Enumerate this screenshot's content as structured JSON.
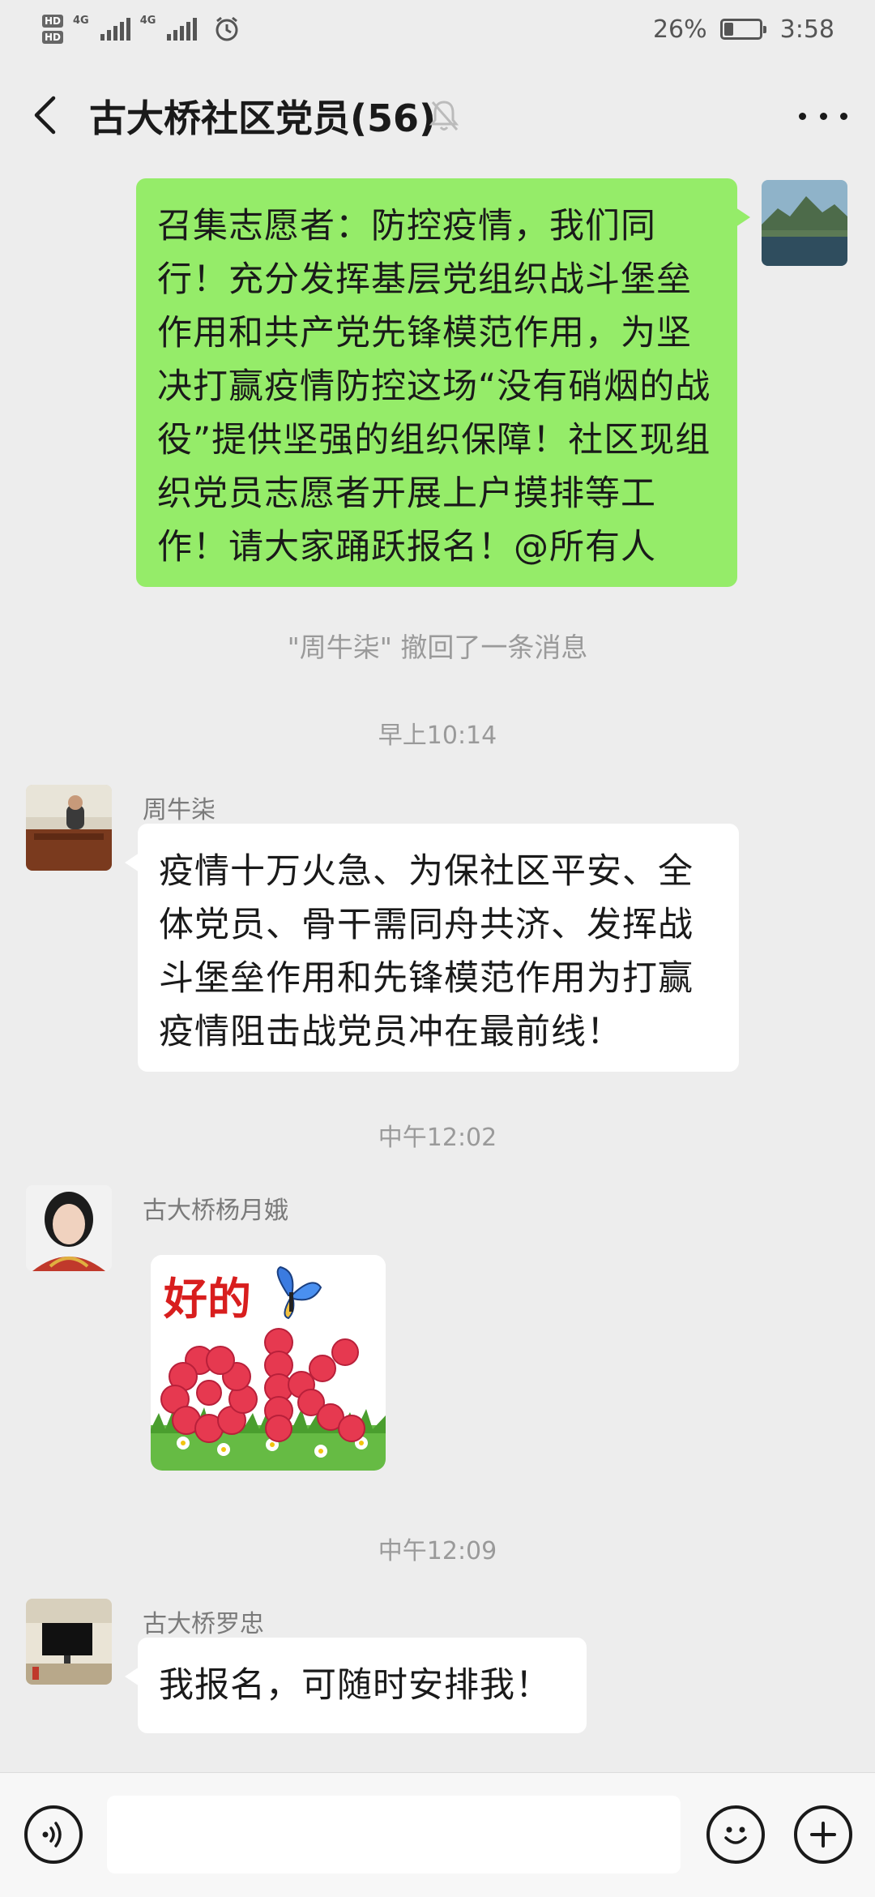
{
  "status_bar": {
    "hd1": "HD",
    "hd2": "HD",
    "net1": "4G",
    "net2": "4G",
    "battery_text": "26%",
    "battery_level": 0.26,
    "time": "3:58"
  },
  "header": {
    "title": "古大桥社区党员(56)"
  },
  "messages": {
    "m1_text": "召集志愿者：防控疫情，我们同行！充分发挥基层党组织战斗堡垒作用和共产党先锋模范作用，为坚决打赢疫情防控这场“没有硝烟的战役”提供坚强的组织保障！社区现组织党员志愿者开展上户摸排等工作！请大家踊跃报名！@所有人",
    "recall_note": "\"周牛柒\" 撤回了一条消息",
    "ts1": "早上10:14",
    "m2_sender": "周牛柒",
    "m2_text": "疫情十万火急、为保社区平安、全体党员、骨干需同舟共济、发挥战斗堡垒作用和先锋模范作用为打赢疫情阻击战党员冲在最前线！",
    "ts2": "中午12:02",
    "m3_sender": "古大桥杨月娥",
    "m3_sticker_text": "好的",
    "m3_sticker_big": "ok",
    "ts3": "中午12:09",
    "m4_sender": "古大桥罗忠",
    "m4_text": "我报名，可随时安排我！"
  },
  "input_bar": {
    "placeholder": ""
  },
  "colors": {
    "mine_bubble": "#95ec69",
    "theirs_bubble": "#ffffff",
    "background": "#ededed"
  }
}
